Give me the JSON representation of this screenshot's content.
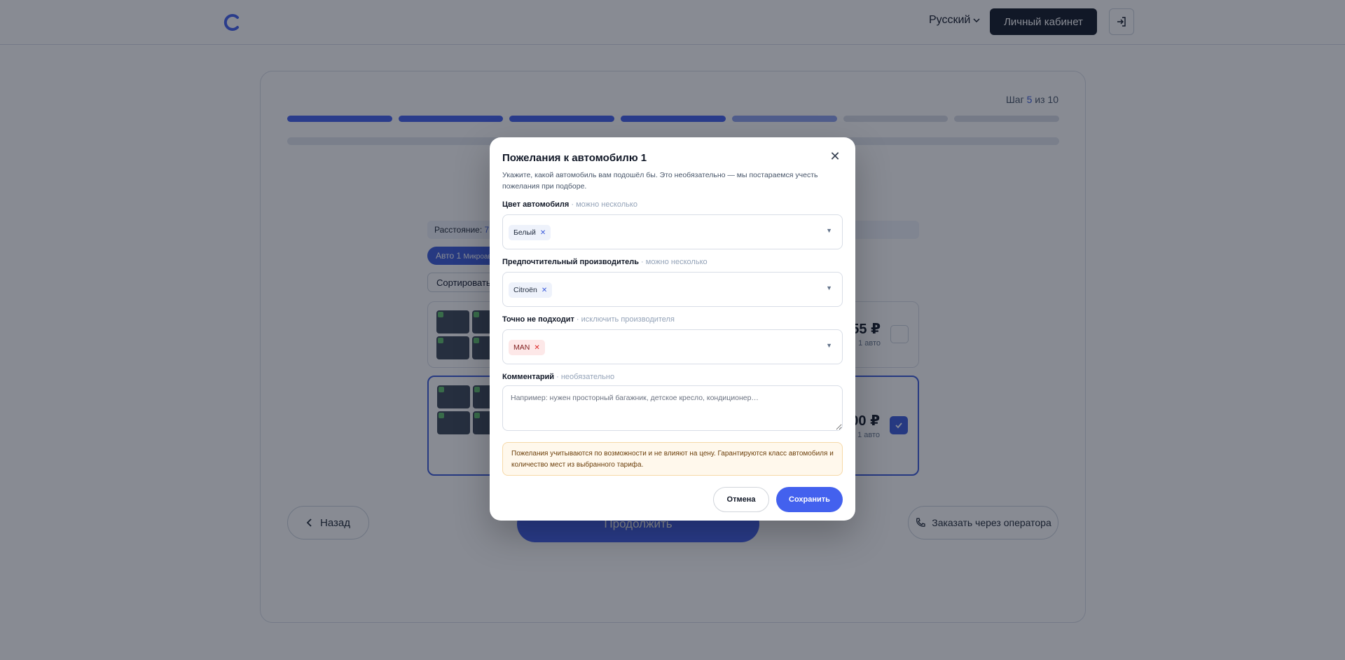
{
  "header": {
    "language": "Русский",
    "cabinet_label": "Личный кабинет"
  },
  "wizard": {
    "step_prefix": "Шаг",
    "step_current": "5",
    "step_separator": "из",
    "step_total": "10",
    "progress_done_segments": 4,
    "progress_total_segments": 7
  },
  "background": {
    "distance_label": "Расстояние:",
    "distance_value": "7.0",
    "car_chip_label": "Авто 1",
    "car_chip_sub": "Микроав",
    "sort_label": "Сортировать:",
    "offers": [
      {
        "price": "55 ₽",
        "price_sub": "1 авто",
        "selected": false
      },
      {
        "price": "00 ₽",
        "price_sub": "1 авто",
        "selected": true
      }
    ],
    "back_label": "Назад",
    "continue_label": "Продолжить",
    "operator_label": "Заказать через оператора"
  },
  "modal": {
    "title": "Пожелания к автомобилю 1",
    "description": "Укажите, какой автомобиль вам подошёл бы. Это необязательно — мы постараемся учесть пожелания при подборе.",
    "color_label": "Цвет автомобиля",
    "color_hint": "· можно несколько",
    "color_tag": "Белый",
    "maker_label": "Предпочтительный производитель",
    "maker_hint": "· можно несколько",
    "maker_tag": "Citroën",
    "exclude_label": "Точно не подходит",
    "exclude_hint": "· исключить производителя",
    "exclude_tag": "MAN",
    "comment_label": "Комментарий",
    "comment_hint": "· необязательно",
    "comment_placeholder": "Например: нужен просторный багажник, детское кресло, кондиционер…",
    "notice": "Пожелания учитываются по возможности и не влияют на цену. Гарантируются класс автомобиля и количество мест из выбранного тарифа.",
    "cancel_label": "Отмена",
    "save_label": "Сохранить"
  },
  "colors": {
    "accent": "#4361ee",
    "dark": "#111827"
  }
}
